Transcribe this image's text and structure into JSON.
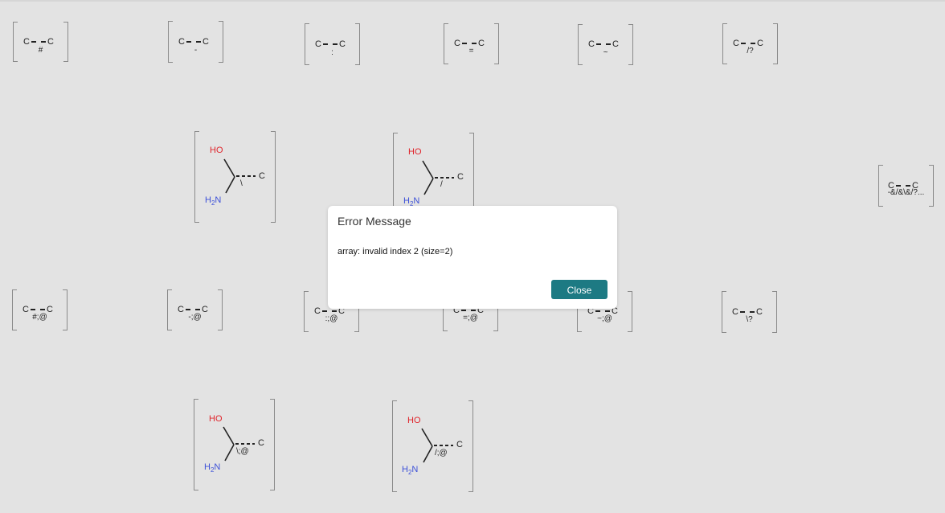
{
  "molecules": [
    {
      "atom_left": "C",
      "atom_right": "C",
      "bond_symbol": "#"
    },
    {
      "atom_left": "C",
      "atom_right": "C",
      "bond_symbol": "-"
    },
    {
      "atom_left": "C",
      "atom_right": "C",
      "bond_symbol": ":"
    },
    {
      "atom_left": "C",
      "atom_right": "C",
      "bond_symbol": "="
    },
    {
      "atom_left": "C",
      "atom_right": "C",
      "bond_symbol": "~"
    },
    {
      "atom_left": "C",
      "atom_right": "C",
      "bond_symbol": "/?"
    },
    {
      "hydroxyl": "HO",
      "amine_h": "H",
      "amine_sub": "2",
      "amine_n": "N",
      "atom_right": "C",
      "bond_symbol": "\\"
    },
    {
      "hydroxyl": "HO",
      "amine_h": "H",
      "amine_sub": "2",
      "amine_n": "N",
      "atom_right": "C",
      "bond_symbol": "/"
    },
    {
      "atom_left": "C",
      "atom_right": "C",
      "bond_symbol": "-&/&\\&/?..."
    },
    {
      "atom_left": "C",
      "atom_right": "C",
      "bond_symbol": "#;@"
    },
    {
      "atom_left": "C",
      "atom_right": "C",
      "bond_symbol": "-;@"
    },
    {
      "atom_left": "C",
      "atom_right": "C",
      "bond_symbol": ":;@"
    },
    {
      "atom_left": "C",
      "atom_right": "C",
      "bond_symbol": "=;@"
    },
    {
      "atom_left": "C",
      "atom_right": "C",
      "bond_symbol": "~;@"
    },
    {
      "atom_left": "C",
      "atom_right": "C",
      "bond_symbol": "\\?"
    },
    {
      "hydroxyl": "HO",
      "amine_h": "H",
      "amine_sub": "2",
      "amine_n": "N",
      "atom_right": "C",
      "bond_symbol": "\\;@"
    },
    {
      "hydroxyl": "HO",
      "amine_h": "H",
      "amine_sub": "2",
      "amine_n": "N",
      "atom_right": "C",
      "bond_symbol": "/;@"
    }
  ],
  "dialog": {
    "title": "Error Message",
    "message": "array: invalid index 2 (size=2)",
    "close_label": "Close"
  },
  "colors": {
    "background": "#e3e3e3",
    "oxygen": "#e0242b",
    "nitrogen": "#3c50d8",
    "button": "#1d7a83"
  }
}
